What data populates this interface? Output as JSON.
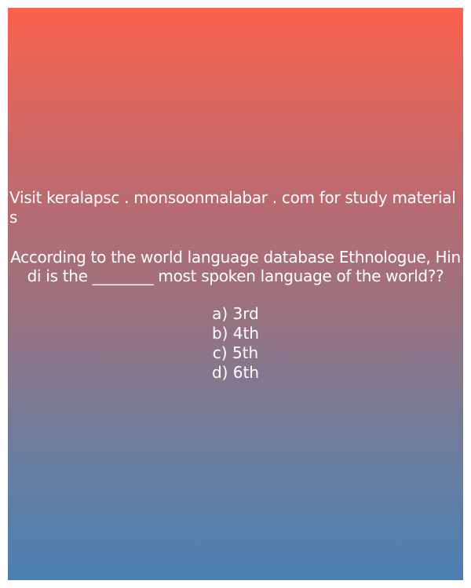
{
  "watermark": "Visit keralapsc . monsoonmalabar . com for study materials",
  "question": " According to the world language database Ethnologue, Hindi is the ________ most spoken language of the world??",
  "options": [
    "a) 3rd",
    "b) 4th",
    "c) 5th",
    "d) 6th"
  ],
  "colors": {
    "gradient_top": "#fb624c",
    "gradient_bottom": "#4a80b2",
    "text": "#ffffff"
  }
}
